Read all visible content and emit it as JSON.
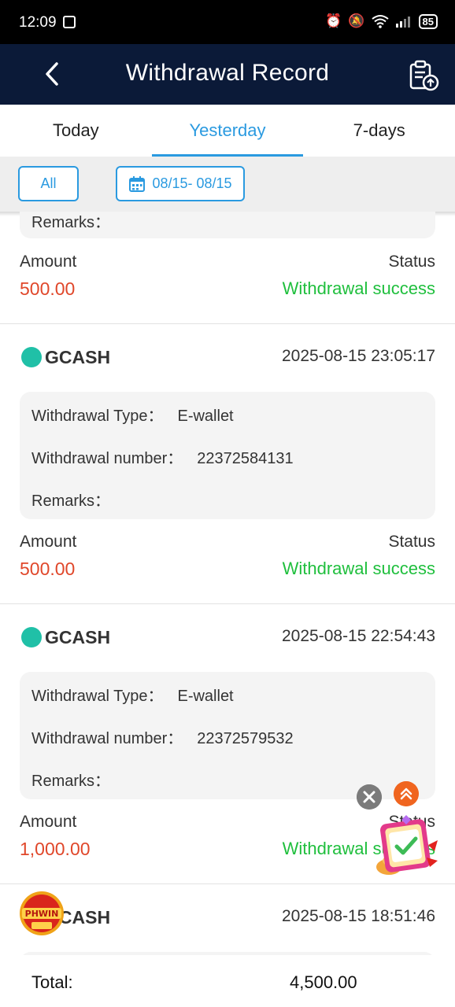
{
  "status_bar": {
    "time": "12:09",
    "battery": "85"
  },
  "header": {
    "title": "Withdrawal Record"
  },
  "tabs": [
    {
      "label": "Today",
      "active": false
    },
    {
      "label": "Yesterday",
      "active": true
    },
    {
      "label": "7-days",
      "active": false
    }
  ],
  "filter": {
    "all_label": "All",
    "date_range": "08/15- 08/15"
  },
  "labels": {
    "remarks": "Remarks：",
    "amount": "Amount",
    "status": "Status",
    "withdrawal_type": "Withdrawal Type：",
    "withdrawal_number": "Withdrawal number："
  },
  "records": [
    {
      "amount": "500.00",
      "status": "Withdrawal success"
    },
    {
      "channel": "GCASH",
      "time": "2025-08-15 23:05:17",
      "type": "E-wallet",
      "number": "22372584131",
      "amount": "500.00",
      "status": "Withdrawal success"
    },
    {
      "channel": "GCASH",
      "time": "2025-08-15 22:54:43",
      "type": "E-wallet",
      "number": "22372579532",
      "amount": "1,000.00",
      "status": "Withdrawal success"
    },
    {
      "channel": "GCASH",
      "time": "2025-08-15 18:51:46"
    }
  ],
  "footer": {
    "total_label": "Total:",
    "total_value": "4,500.00"
  },
  "floating": {
    "promo_logo_text": "PHWIN"
  },
  "colors": {
    "header_bg": "#0b1a38",
    "accent": "#2a9ae0",
    "amount": "#e0472a",
    "success": "#1fbf3d"
  }
}
